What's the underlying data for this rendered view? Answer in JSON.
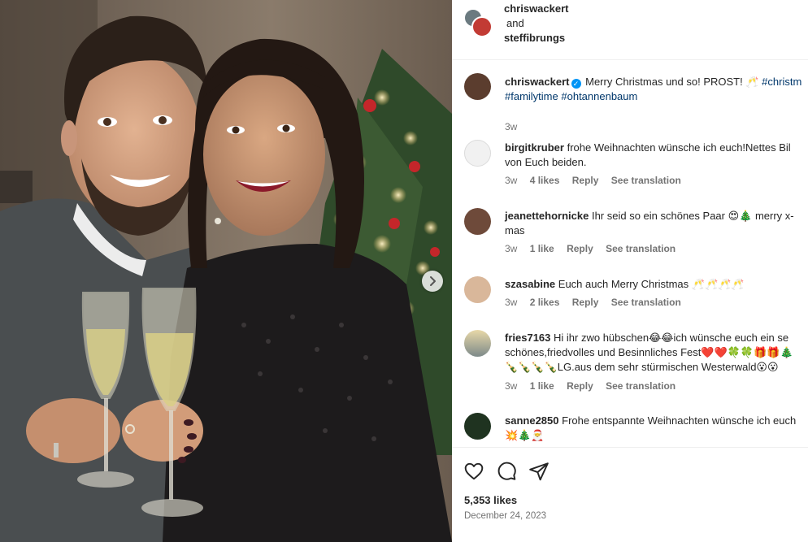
{
  "header": {
    "user1": "chriswackert",
    "and": "and",
    "user2": "steffibrungs"
  },
  "caption": {
    "user": "chriswackert",
    "text": "Merry Christmas und so! PROST! 🥂",
    "tag1": "#christm",
    "tag2": "#familytime",
    "tag3": "#ohtannenbaum",
    "time": "3w"
  },
  "comments": [
    {
      "user": "birgitkruber",
      "text": "frohe Weihnachten wünsche ich euch!Nettes Bil",
      "text2": "von Euch beiden.",
      "time": "3w",
      "likes": "4 likes",
      "reply": "Reply",
      "translate": "See translation"
    },
    {
      "user": "jeanettehornicke",
      "text": "Ihr seid so ein schönes Paar 😍🎄 merry x-",
      "text2": "mas",
      "time": "3w",
      "likes": "1 like",
      "reply": "Reply",
      "translate": "See translation"
    },
    {
      "user": "szasabine",
      "text": "Euch auch Merry Christmas 🥂🥂🥂🥂",
      "text2": "",
      "time": "3w",
      "likes": "2 likes",
      "reply": "Reply",
      "translate": "See translation"
    },
    {
      "user": "fries7163",
      "text": "Hi ihr zwo hübschen😂😂ich wünsche euch ein se",
      "text2": "schönes,friedvolles und Besinnliches Fest❤️❤️🍀🍀🎁🎁🎄",
      "text3": "🍾🍾🍾🍾LG.aus dem sehr stürmischen Westerwald😮😮",
      "time": "3w",
      "likes": "1 like",
      "reply": "Reply",
      "translate": "See translation"
    },
    {
      "user": "sanne2850",
      "text": "Frohe entspannte Weihnachten wünsche ich euch",
      "text2": "💥🎄🎅",
      "time": "",
      "likes": "",
      "reply": "",
      "translate": ""
    }
  ],
  "footer": {
    "likes": "5,353 likes",
    "date": "December 24, 2023"
  },
  "icons": {
    "like": "heart-icon",
    "comment": "comment-icon",
    "share": "paper-plane-icon",
    "next": "chevron-right-icon"
  },
  "colors": {
    "link": "#00376b",
    "verified": "#0095f6",
    "meta": "#737373"
  }
}
